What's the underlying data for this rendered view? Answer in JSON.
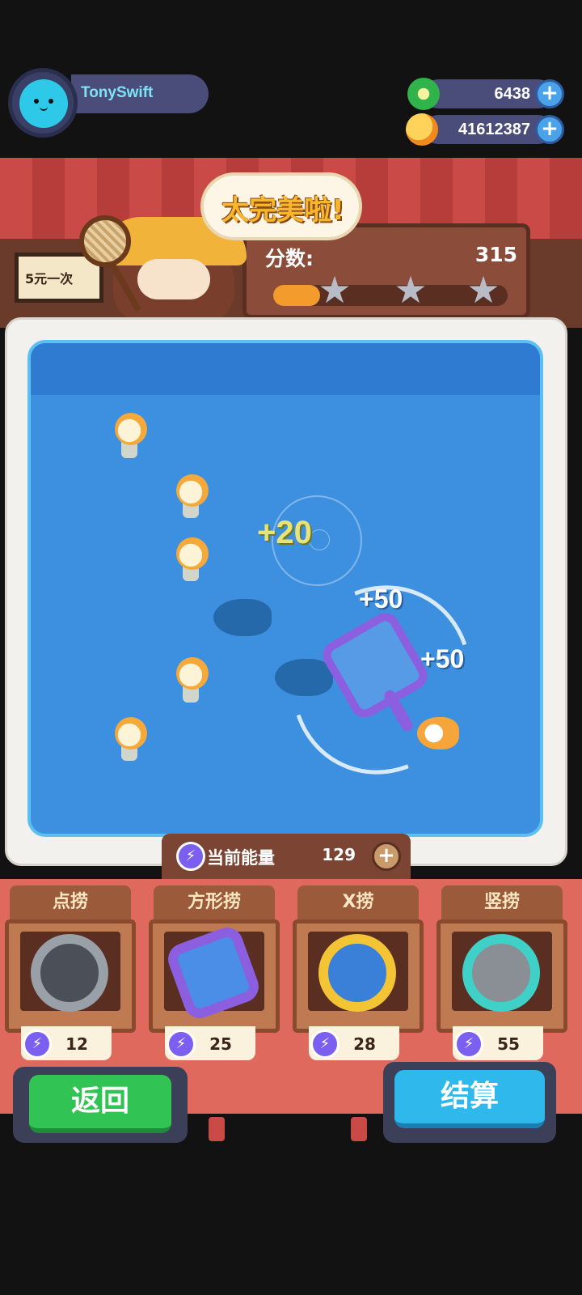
{
  "player": {
    "name": "TonySwift"
  },
  "currencies": [
    {
      "icon": "green-gem-icon",
      "value": "6438"
    },
    {
      "icon": "orange-planet-icon",
      "value": "41612387"
    }
  ],
  "stall": {
    "sign_text": "5元一次"
  },
  "feedback": {
    "text": "太完美啦!"
  },
  "score": {
    "label": "分数:",
    "value": "315",
    "progress": 0.2,
    "stars_earned": 0,
    "stars_total": 3
  },
  "pond_popups": [
    "+20",
    "+50",
    "+50"
  ],
  "energy": {
    "label": "当前能量",
    "value": "129"
  },
  "tools": [
    {
      "name": "点捞",
      "cost": "12",
      "color": "#9aa0a8"
    },
    {
      "name": "方形捞",
      "cost": "25",
      "color": "#8b5fe0"
    },
    {
      "name": "X捞",
      "cost": "28",
      "color": "#f3c534"
    },
    {
      "name": "竖捞",
      "cost": "55",
      "color": "#3fd1c8"
    }
  ],
  "buttons": {
    "back": "返回",
    "settle": "结算"
  },
  "colors": {
    "pond": "#3d8fe0",
    "panel": "#e0695e",
    "back": "#31c454",
    "settle": "#2eb8ec"
  }
}
